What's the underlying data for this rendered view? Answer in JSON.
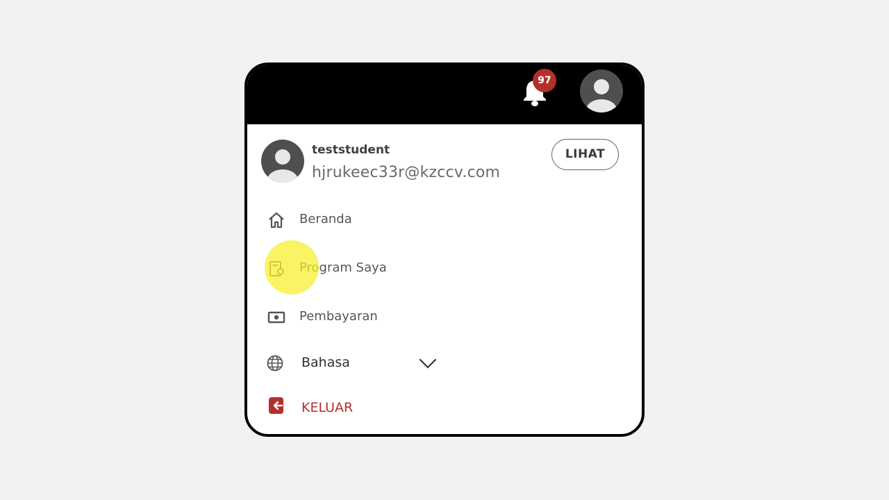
{
  "header": {
    "notification_count": "97",
    "accent_color": "#b2302b"
  },
  "profile": {
    "username": "teststudent",
    "email": "hjrukeec33r@kzccv.com",
    "view_button_label": "LIHAT"
  },
  "menu": {
    "items": [
      {
        "label": "Beranda",
        "icon": "home-icon"
      },
      {
        "label": "Program Saya",
        "icon": "my-program-icon"
      },
      {
        "label": "Pembayaran",
        "icon": "payment-icon"
      }
    ],
    "language": {
      "label": "Bahasa",
      "icon": "globe-icon"
    },
    "logout": {
      "label": "KELUAR",
      "icon": "logout-icon"
    }
  }
}
